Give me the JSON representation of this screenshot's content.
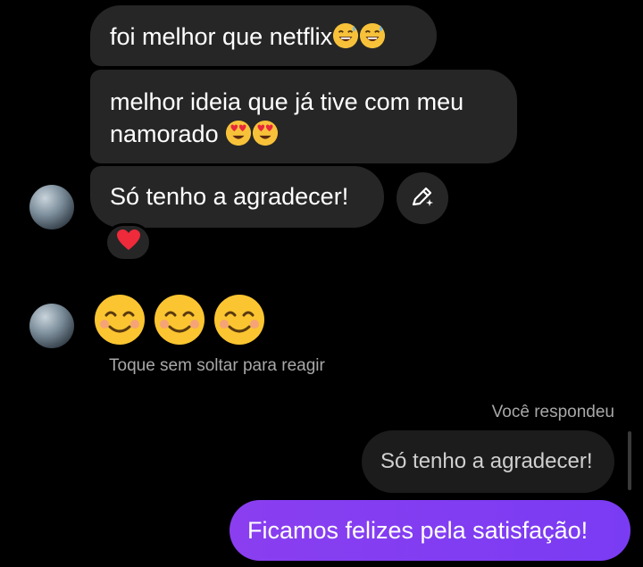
{
  "messages": [
    {
      "text": "foi melhor que netflix",
      "emoji_label": "sweat-smile-emoji x2"
    },
    {
      "text_line1": "melhor ideia que já tive com meu",
      "text_line2": "namorado",
      "emoji_label": "heart-eyes-emoji x2"
    },
    {
      "text": "Só tenho a agradecer!",
      "reaction": "heart"
    }
  ],
  "emoji_message": {
    "emojis": [
      "smiling-face",
      "smiling-face",
      "smiling-face"
    ]
  },
  "hint": "Toque sem soltar para reagir",
  "reply": {
    "header": "Você respondeu",
    "quoted_text": "Só tenho a agradecer!",
    "sent_text": "Ficamos felizes pela satisfação!"
  },
  "colors": {
    "incoming_bubble": "#262626",
    "outgoing_bubble": "#7a3cf3",
    "secondary_text": "#a8a8a8"
  },
  "icons": [
    "edit-sparkle-icon",
    "heart-reaction-icon",
    "avatar"
  ]
}
